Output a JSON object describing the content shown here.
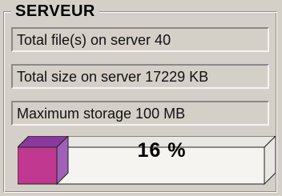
{
  "group": {
    "title": "SERVEUR"
  },
  "fields": {
    "total_files": "Total file(s) on server 40",
    "total_size": "Total size on server 17229 KB",
    "max_storage": "Maximum storage 100 MB"
  },
  "progress": {
    "label": "16 %",
    "fraction": 0.16,
    "fill_color": "#c03890",
    "fill_top_color": "#8a3a9c",
    "fill_side_color": "#a060b8"
  }
}
